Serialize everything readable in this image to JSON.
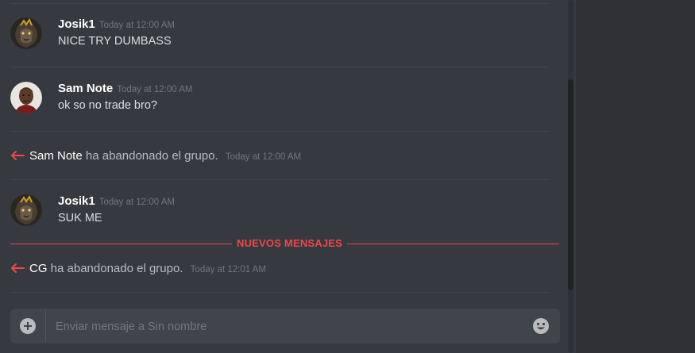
{
  "messages": [
    {
      "author": "Josik1",
      "timestamp": "Today at 12:00 AM",
      "text": "NICE TRY DUMBASS",
      "avatar": "lion-avatar"
    },
    {
      "author": "Sam Note",
      "timestamp": "Today at 12:00 AM",
      "text": "ok so no trade bro?",
      "avatar": "person-avatar"
    },
    {
      "author": "Josik1",
      "timestamp": "Today at 12:00 AM",
      "text": "SUK ME",
      "avatar": "lion-avatar"
    }
  ],
  "system_messages": [
    {
      "user": "Sam Note",
      "action": "ha abandonado el grupo.",
      "timestamp": "Today at 12:00 AM"
    },
    {
      "user": "CG",
      "action": "ha abandonado el grupo.",
      "timestamp": "Today at 12:01 AM"
    }
  ],
  "new_messages_label": "NUEVOS MENSAJES",
  "composer": {
    "placeholder": "Enviar mensaje a Sin nombre"
  },
  "colors": {
    "background": "#36393f",
    "accent_red": "#f04747",
    "composer": "#40444b",
    "sidebar": "#2f3136"
  },
  "icons": {
    "leave": "left-arrow-icon",
    "upload": "plus-circle-icon",
    "emoji": "emoji-icon"
  }
}
